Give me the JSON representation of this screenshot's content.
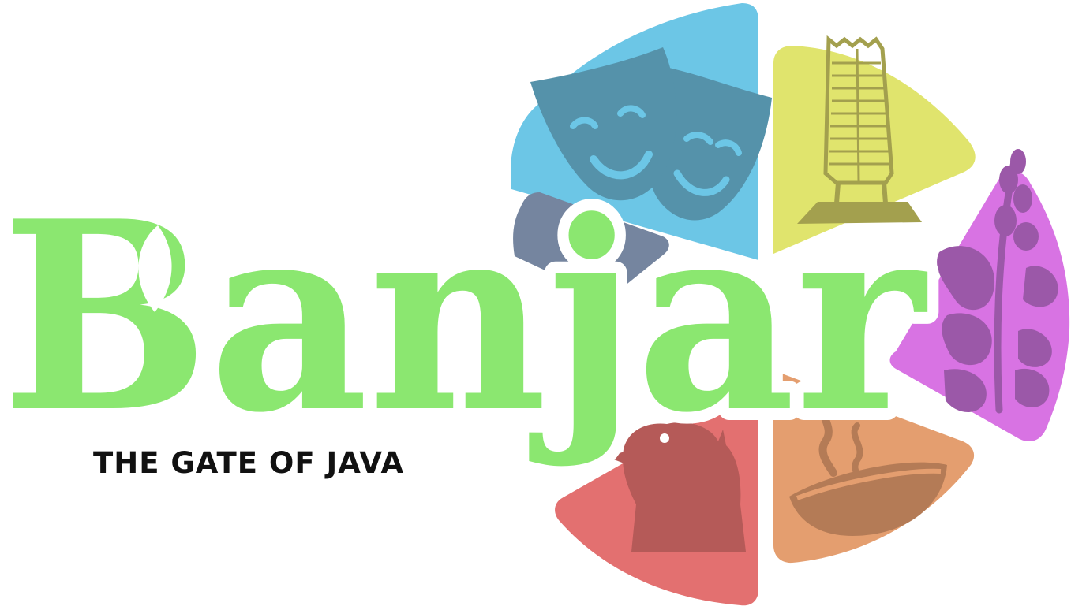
{
  "logo": {
    "wordmark": "Banjar",
    "tagline": "THE GATE OF JAVA",
    "colors": {
      "wordmark": "#8be770",
      "wordmark_outline": "#ffffff",
      "leaf": "#ffffff",
      "tagline": "#111111",
      "segment_theatre": "#6cc6e6",
      "segment_tower": "#e0e46d",
      "segment_plant": "#d873e3",
      "segment_bowl": "#e49e6f",
      "segment_bird": "#e37070",
      "segment_slate": "#75859f",
      "icon_masks": "#5592aa",
      "icon_tower": "#a3a04e",
      "icon_plant": "#9b58a8",
      "icon_bowl": "#b47b56",
      "icon_bird": "#b55a58"
    },
    "icons": [
      "theatre-masks-icon",
      "tower-icon",
      "flowering-plant-icon",
      "steaming-bowl-icon",
      "bird-mascot-icon"
    ]
  }
}
